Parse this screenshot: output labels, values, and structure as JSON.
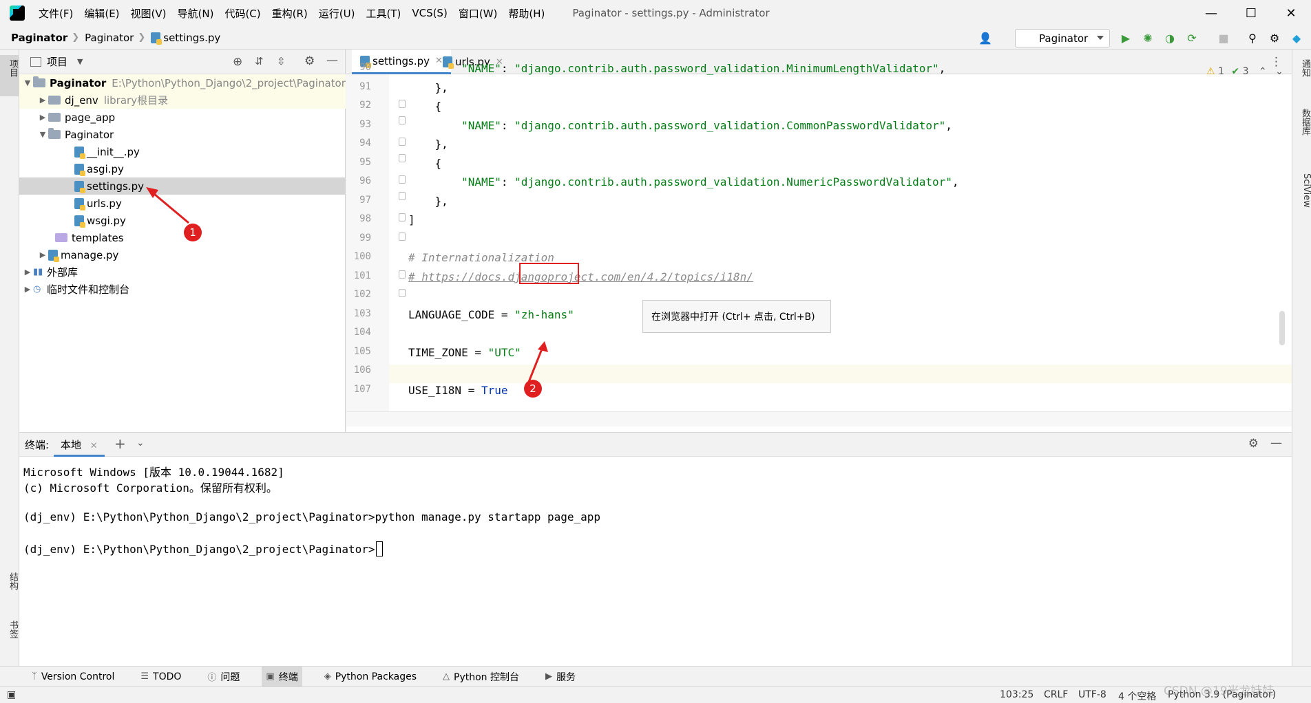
{
  "menu": [
    "文件(F)",
    "编辑(E)",
    "视图(V)",
    "导航(N)",
    "代码(C)",
    "重构(R)",
    "运行(U)",
    "工具(T)",
    "VCS(S)",
    "窗口(W)",
    "帮助(H)"
  ],
  "window_title": "Paginator - settings.py - Administrator",
  "breadcrumb": [
    "Paginator",
    "Paginator",
    "settings.py"
  ],
  "run_config": "Paginator",
  "left_strip": {
    "project": "项目",
    "structure": "结构",
    "bookmarks": "书签"
  },
  "right_strip": {
    "notifications": "通知",
    "database": "数据库",
    "sciview": "SciView"
  },
  "project_panel": {
    "title": "项目",
    "tree": [
      {
        "label": "Paginator",
        "extra": "E:\\Python\\Python_Django\\2_project\\Paginator"
      },
      {
        "label": "dj_env",
        "extra": "library根目录"
      },
      {
        "label": "page_app"
      },
      {
        "label": "Paginator"
      },
      {
        "label": "__init__.py"
      },
      {
        "label": "asgi.py"
      },
      {
        "label": "settings.py"
      },
      {
        "label": "urls.py"
      },
      {
        "label": "wsgi.py"
      },
      {
        "label": "templates"
      },
      {
        "label": "manage.py"
      },
      {
        "label": "外部库"
      },
      {
        "label": "临时文件和控制台"
      }
    ]
  },
  "editor": {
    "tabs": [
      "settings.py",
      "urls.py"
    ],
    "inspection": {
      "warnings": "1",
      "ok": "3"
    },
    "lines": [
      {
        "num": "90",
        "text": "        \"NAME\": \"django.contrib.auth.password_validation.MinimumLengthValidator\","
      },
      {
        "num": "91",
        "text": "    },"
      },
      {
        "num": "92",
        "text": "    {"
      },
      {
        "num": "93",
        "text": "        \"NAME\": \"django.contrib.auth.password_validation.CommonPasswordValidator\","
      },
      {
        "num": "94",
        "text": "    },"
      },
      {
        "num": "95",
        "text": "    {"
      },
      {
        "num": "96",
        "text": "        \"NAME\": \"django.contrib.auth.password_validation.NumericPasswordValidator\","
      },
      {
        "num": "97",
        "text": "    },"
      },
      {
        "num": "98",
        "text": "]"
      },
      {
        "num": "99",
        "text": ""
      },
      {
        "num": "100",
        "text": "# Internationalization"
      },
      {
        "num": "101",
        "text": "# https://docs.djangoproject.com/en/4.2/topics/i18n/"
      },
      {
        "num": "102",
        "text": ""
      },
      {
        "num": "103",
        "text": "LANGUAGE_CODE = \"zh-hans\""
      },
      {
        "num": "104",
        "text": ""
      },
      {
        "num": "105",
        "text": "TIME_ZONE = \"UTC\""
      },
      {
        "num": "106",
        "text": ""
      },
      {
        "num": "107",
        "text": "USE_I18N = True"
      }
    ],
    "tooltip": "在浏览器中打开 (Ctrl+ 点击, Ctrl+B)"
  },
  "terminal": {
    "label": "终端:",
    "tab": "本地",
    "lines": [
      "Microsoft Windows [版本 10.0.19044.1682]",
      "(c) Microsoft Corporation。保留所有权利。",
      "",
      "(dj_env) E:\\Python\\Python_Django\\2_project\\Paginator>python manage.py startapp page_app",
      "",
      "(dj_env) E:\\Python\\Python_Django\\2_project\\Paginator>"
    ]
  },
  "bottom_tabs": [
    "Version Control",
    "TODO",
    "问题",
    "终端",
    "Python Packages",
    "Python 控制台",
    "服务"
  ],
  "status": {
    "position": "103:25",
    "line_sep": "CRLF",
    "encoding": "UTF-8",
    "indent": "4 个空格",
    "interpreter": "Python 3.9 (Paginator)",
    "watermark": "CSDN @19米龙娃娃"
  },
  "annotations": [
    "1",
    "2"
  ]
}
